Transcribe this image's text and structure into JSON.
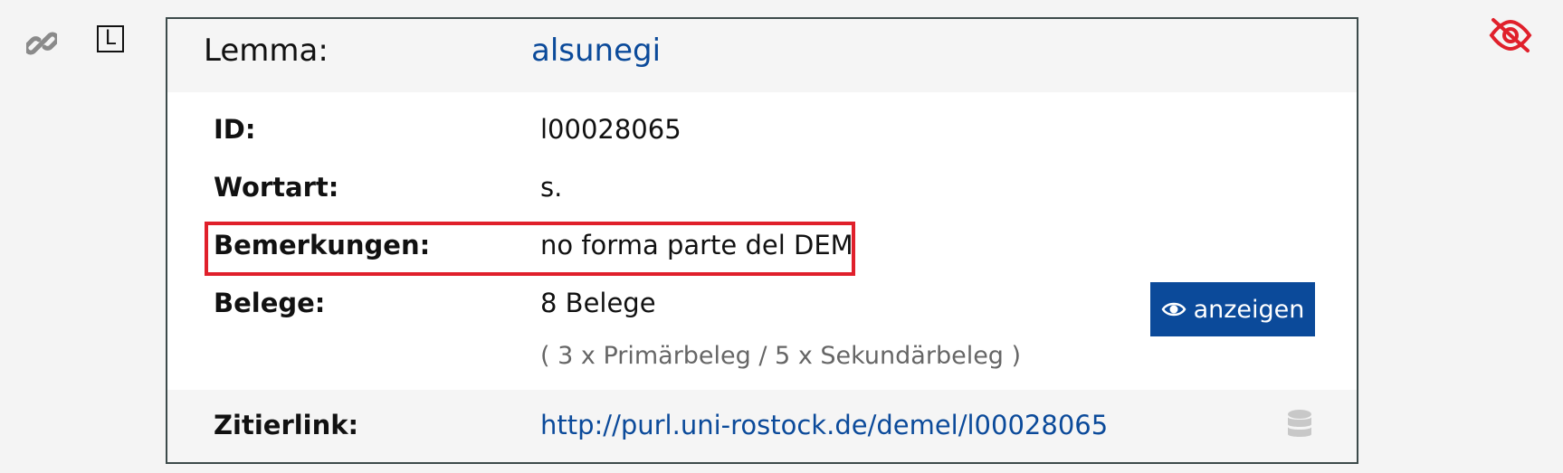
{
  "side_icons": {
    "link_icon": "link-icon",
    "l_icon": "L",
    "visibility_icon": "eye-off-icon"
  },
  "colors": {
    "accent": "#0b4a9a",
    "highlight": "#e0202b",
    "visibility_icon": "#e0202b"
  },
  "entry": {
    "lemma_label": "Lemma:",
    "lemma_value": "alsunegi",
    "rows": [
      {
        "label": "ID:",
        "value": "l00028065"
      },
      {
        "label": "Wortart:",
        "value": "s."
      },
      {
        "label": "Bemerkungen:",
        "value": "no forma parte del DEM"
      },
      {
        "label": "Belege:",
        "value": "8  Belege"
      }
    ],
    "belege_breakdown": "( 3 x Primärbeleg / 5 x Sekundärbeleg  )",
    "show_button_label": "anzeigen",
    "citation_label": "Zitierlink:",
    "citation_url": "http://purl.uni-rostock.de/demel/l00028065"
  }
}
